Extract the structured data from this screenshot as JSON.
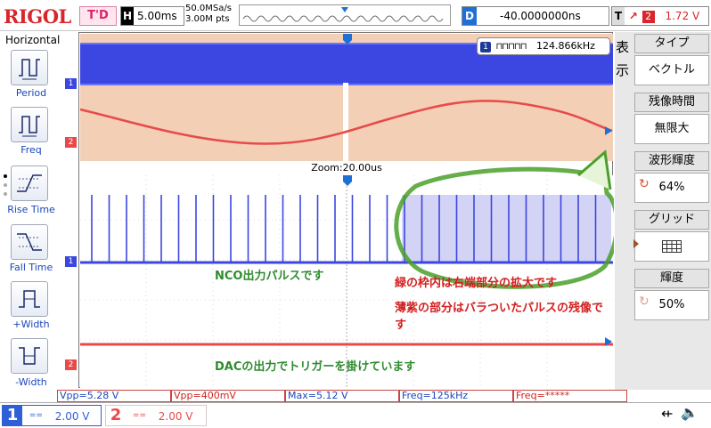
{
  "topbar": {
    "logo": "RIGOL",
    "trigger_status": "T'D",
    "timebase_label": "H",
    "timebase_value": "5.00ms",
    "sample_rate": "50.0MSa/s",
    "memory_depth": "3.00M pts",
    "delay_label": "D",
    "delay_value": "-40.0000000ns",
    "trigger_label": "T",
    "trigger_channel": "2",
    "trigger_level": "1.72 V"
  },
  "left_panel": {
    "title": "Horizontal",
    "buttons": [
      {
        "label": "Period",
        "icon": "period-icon"
      },
      {
        "label": "Freq",
        "icon": "freq-icon"
      },
      {
        "label": "Rise Time",
        "icon": "rise-time-icon"
      },
      {
        "label": "Fall Time",
        "icon": "fall-time-icon"
      },
      {
        "label": "+Width",
        "icon": "positive-width-icon"
      },
      {
        "label": "-Width",
        "icon": "negative-width-icon"
      }
    ]
  },
  "screen": {
    "freq_counter_channel": "1",
    "freq_counter_value": "124.866kHz",
    "zoom_label": "Zoom:20.00us",
    "ch1_marker": "1",
    "ch2_marker": "2",
    "trigger_marker": "T",
    "annotation_nco": "NCO出力パルスです",
    "annotation_box": "緑の枠内は右端部分の拡大です",
    "annotation_ghost": "薄紫の部分はバラついたパルスの残像です",
    "annotation_dac": "DACの出力でトリガーを掛けています"
  },
  "right_menu": {
    "header": "表示",
    "items": [
      {
        "title": "タイプ",
        "value": "ベクトル"
      },
      {
        "title": "残像時間",
        "value": "無限大"
      },
      {
        "title": "波形輝度",
        "value": "64%"
      },
      {
        "title": "グリッド",
        "value": ""
      },
      {
        "title": "輝度",
        "value": "50%"
      }
    ]
  },
  "measurements": [
    "Vpp=5.28 V",
    "Vpp=400mV",
    "Max=5.12 V",
    "Freq=125kHz",
    "Freq=*****"
  ],
  "channels": {
    "ch1": {
      "number": "1",
      "coupling": "==",
      "scale": "2.00 V"
    },
    "ch2": {
      "number": "2",
      "coupling": "==",
      "scale": "2.00 V"
    }
  },
  "colors": {
    "ch1": "#3c46e0",
    "ch2": "#e84a4a",
    "annotation_green": "#2e8b2e",
    "annotation_red": "#d22020",
    "logo": "#d9252b"
  }
}
